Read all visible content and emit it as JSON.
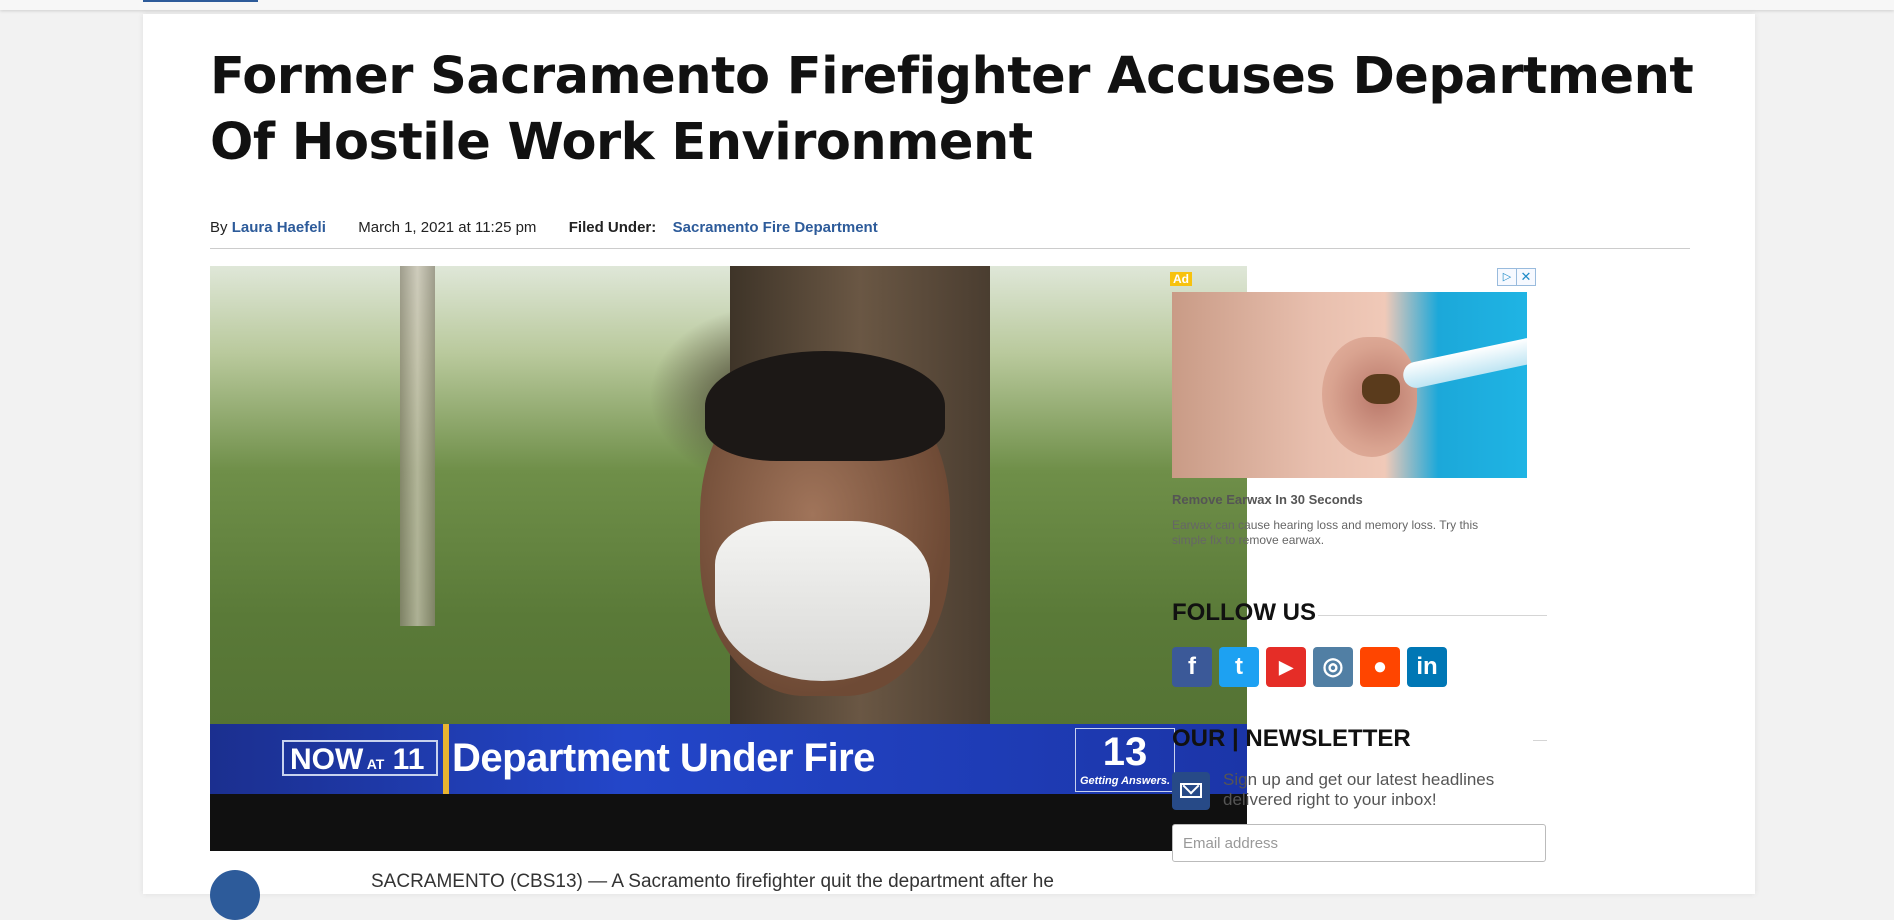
{
  "article": {
    "headline": "Former Sacramento Firefighter Accuses Department Of Hostile Work Environment",
    "by_label": "By",
    "author": "Laura Haefeli",
    "date": "March 1, 2021 at 11:25 pm",
    "filed_under_label": "Filed Under:",
    "category": "Sacramento Fire Department",
    "body_start": "SACRAMENTO (CBS13) — A Sacramento firefighter quit the department after he"
  },
  "video": {
    "badge_now": "NOW",
    "badge_at": "AT",
    "badge_11": "11",
    "lower_third": "Department Under Fire",
    "station_number": "13",
    "station_tagline": "Getting Answers."
  },
  "ad": {
    "label": "Ad",
    "adchoices": "▷",
    "close": "✕",
    "title": "Remove Earwax In 30 Seconds",
    "description": "Earwax can cause hearing loss and memory loss. Try this simple fix to remove earwax."
  },
  "sidebar": {
    "follow_title": "FOLLOW US",
    "social": [
      {
        "name": "facebook",
        "glyph": "f",
        "color": "#3b5998"
      },
      {
        "name": "twitter",
        "glyph": "t",
        "color": "#1da1f2"
      },
      {
        "name": "youtube",
        "glyph": "▶",
        "color": "#e52d27"
      },
      {
        "name": "instagram",
        "glyph": "◎",
        "color": "#517fa4"
      },
      {
        "name": "reddit",
        "glyph": "●",
        "color": "#ff4500"
      },
      {
        "name": "linkedin",
        "glyph": "in",
        "color": "#0077b5"
      }
    ],
    "newsletter_title": "OUR | NEWSLETTER",
    "newsletter_text": "Sign up and get our latest headlines delivered right to your inbox!",
    "email_placeholder": "Email address"
  }
}
